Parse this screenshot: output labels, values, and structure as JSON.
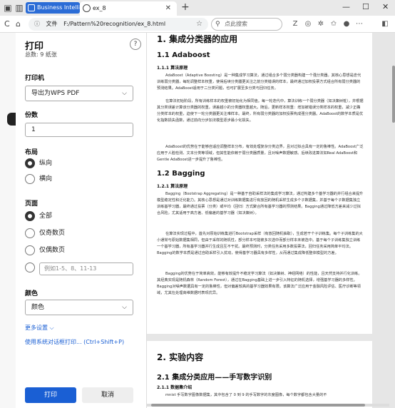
{
  "browser": {
    "tab_bi_label": "Business Intelligence",
    "tab_active_label": "ex_8",
    "address": "F:/Pattern%20recognition/ex_8.html",
    "address_prefix": "文件",
    "search_placeholder": "点此搜索",
    "new_tab": "+",
    "minimize": "—",
    "maximize": "☐",
    "close": "✕"
  },
  "print": {
    "title": "打印",
    "total": "总数: 9 纸张",
    "help": "?",
    "printer_label": "打印机",
    "printer_value": "导出为WPS PDF",
    "copies_label": "份数",
    "copies_value": "1",
    "layout_label": "布局",
    "layout_options": [
      "纵向",
      "横向"
    ],
    "pages_label": "页面",
    "pages_options": [
      "全部",
      "仅奇数页",
      "仅偶数页"
    ],
    "pages_range_placeholder": "例如1-5、8、11-13",
    "color_label": "颜色",
    "color_value": "颜色",
    "more_settings": "更多设置 ⌵",
    "system_dialog": "使用系统对话框打印... (Ctrl+Shift+P)",
    "print_button": "打印",
    "cancel_button": "取消"
  },
  "document": {
    "h1": "1. 集成分类器的应用",
    "s1_title": "1.1 Adaboost",
    "s1_sub": "1.1.1 算法原理",
    "s1_p1": "AdaBoost（Adaptive Boosting）是一种集成学习算法，通过组合多个弱分类器构建一个强分类器。其核心思想是迭代训练弱分类器，每轮调整样本权重，使得后续分类器更关注之前分类错误的样本，最终通过加权投票方式组合所有弱分类器的预测结果。AdaBoost适用于二分类问题，也可扩展至多分类与回归任务。",
    "s1_p2": "在算法初始阶段，所有训练样本的权重被初始化为相同值。每一轮迭代中，算法训练一个弱分类器（如决策树桩），并根据其分类误差计算该分类器的权重，误差越小的分类器权重越大。随后，更新样本权重：增加被错误分类样本的权重，减少正确分类样本的权重，迫使下一轮分类器更关注难样本。最终，所有弱分类器的加权投票构成强分类器。AdaBoost的数学本质是优化指数损失函数，通过前向分步加法模型逐步最小化损失。",
    "s1_p3": "AdaBoost的优势在于能够自适应调整样本分布，有效处理复杂分类边界，且对过拟合具有一定的鲁棒性。AdaBoost广泛应用于人脸检测、文本分类等领域，但其性能依赖于弱分类器质量，且对噪声数据敏感。后续改进算法如Real AdaBoost和Gentle AdaBoost进一步提升了鲁棒性。",
    "s2_title": "1.2 Bagging",
    "s2_sub": "1.2.1 算法原理",
    "s2_p1": "Bagging（Bootstrap Aggregating）是一种基于自助采样法的集成学习算法，通过构建多个基学习器的并行组合来提升模型稳定性和泛化能力。其核心思想是通过对训练数据集进行有放回的随机采样生成多个子数据集，并基于每个子数据集独立训练基学习器，最终通过投票（分类）或平均（回归）方式聚合所有基学习器的预测结果。Bagging通过降低方差来减少过拟合风险，尤其适用于高方差、低偏差的基学习器（如决策树）。",
    "s2_p2": "在算法实现过程中，首先对原始训练集进行Bootstrap采样（有放回随机抽取），生成若干个子训练集。每个子训练集的大小通常与原始数据集相同，但由于采样的随机性，部分样本可能被多次选中而部分样本未被选中。基于每个子训练集独立训练一个基学习器，所有基学习器并行生成且互不干扰。最终预测时，分类任务采用多数投票法，回归任务采用简单平均法。Bagging的数学本质是通过自助采样引入扰动，使得基学习器具有多样性，从而通过集成降低整体模型的方差。",
    "s2_p3": "Bagging的优势在于简单高效，能够有效提升不稳定学习算法（如决策树、神经网络）的性能，且天然支持并行化训练。其经典实现是随机森林（Random Forest），通过在Bagging基础上进一步引入特征的随机选择，增强基学习器的多样性。Bagging对噪声数据具有一定的鲁棒性，但对偏差较高的基学习器效果有限。该算法广泛应用于金融风险评估、医疗诊断等领域，尤其在处理高维数据时表现优异。",
    "h1b": "2. 实验内容",
    "s3_title": "2.1 集成分类应用——手写数字识别",
    "s3_sub": "2.1.1 数据集介绍",
    "s3_p1": "mnist 手写数字图像数据集，其中包含了 0 到 9 的手写数字的灰度图像，每个数字都包含大量的不"
  }
}
